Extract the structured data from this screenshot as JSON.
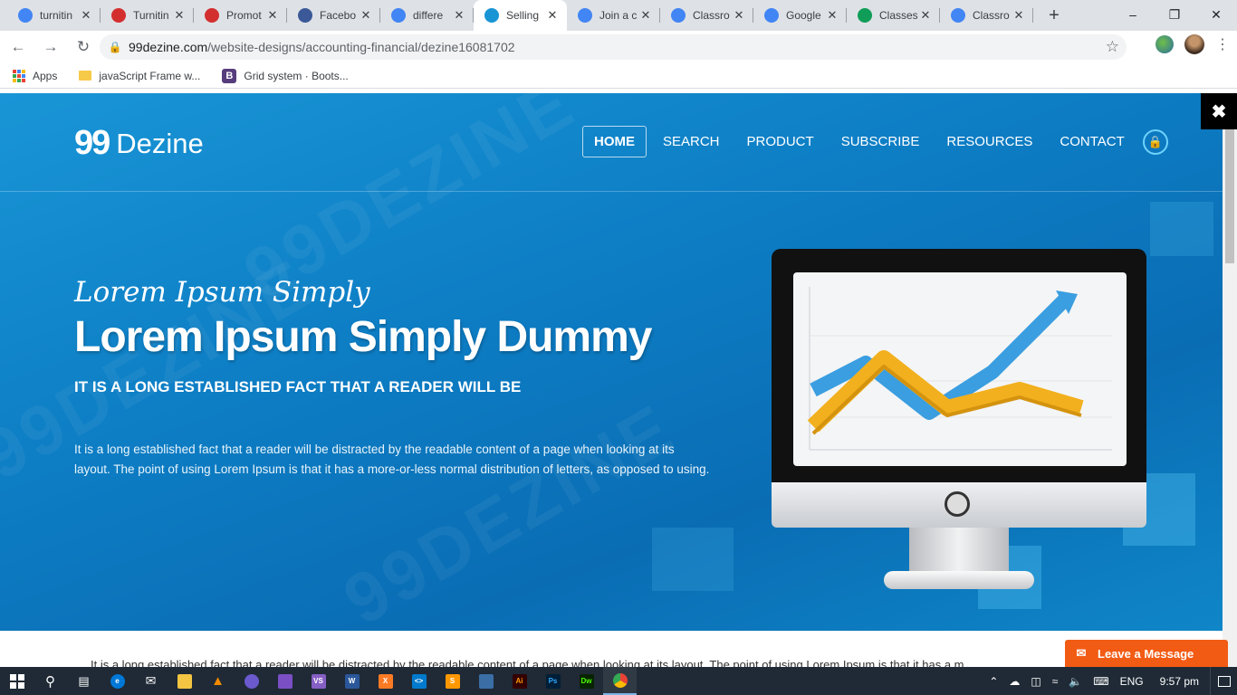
{
  "browser": {
    "tabs": [
      {
        "title": "turnitin",
        "favicon": "google-icon",
        "color": "#4285f4"
      },
      {
        "title": "Turnitin",
        "favicon": "turnitin-icon",
        "color": "#d32f2f"
      },
      {
        "title": "Promot",
        "favicon": "turnitin-icon",
        "color": "#d32f2f"
      },
      {
        "title": "Facebo",
        "favicon": "facebook-icon",
        "color": "#3b5998"
      },
      {
        "title": "differe",
        "favicon": "google-icon",
        "color": "#4285f4"
      },
      {
        "title": "Selling",
        "favicon": "99dezine-icon",
        "color": "#1995d6",
        "active": true
      },
      {
        "title": "Join a c",
        "favicon": "google-icon",
        "color": "#4285f4"
      },
      {
        "title": "Classro",
        "favicon": "google-icon",
        "color": "#4285f4"
      },
      {
        "title": "Google",
        "favicon": "google-icon",
        "color": "#4285f4"
      },
      {
        "title": "Classes",
        "favicon": "classroom-icon",
        "color": "#0f9d58"
      },
      {
        "title": "Classro",
        "favicon": "google-icon",
        "color": "#4285f4"
      }
    ],
    "url_host": "99dezine.com",
    "url_path": "/website-designs/accounting-financial/dezine16081702",
    "bookmarks": [
      {
        "label": "Apps"
      },
      {
        "label": "javaScript Frame w..."
      },
      {
        "label": "Grid system · Boots..."
      }
    ]
  },
  "site": {
    "logo_mark": "99",
    "logo_text": "Dezine",
    "nav": [
      "HOME",
      "SEARCH",
      "PRODUCT",
      "SUBSCRIBE",
      "RESOURCES",
      "CONTACT"
    ],
    "hero": {
      "script_title": "Lorem Ipsum Simply",
      "headline": "Lorem Ipsum Simply Dummy",
      "subheading": "IT IS A LONG ESTABLISHED FACT THAT A READER WILL BE",
      "paragraph": "It is a long established fact that a reader will be distracted by the readable content of a page when looking at its layout. The point of using Lorem Ipsum is that it has a more-or-less normal distribution of letters, as opposed to using."
    },
    "below_text": "It is a long established fact that a reader will be distracted by the readable content of a page when looking at its layout. The point of using Lorem Ipsum is that it has a m...",
    "watermark": "99DEZINE",
    "leave_message": "Leave a Message",
    "close_glyph": "✖"
  },
  "taskbar": {
    "language": "ENG",
    "time": "9:57 pm"
  },
  "colors": {
    "hero_blue": "#1995d6",
    "chat_orange": "#f25b14",
    "taskbar_bg": "#1f2a36"
  }
}
